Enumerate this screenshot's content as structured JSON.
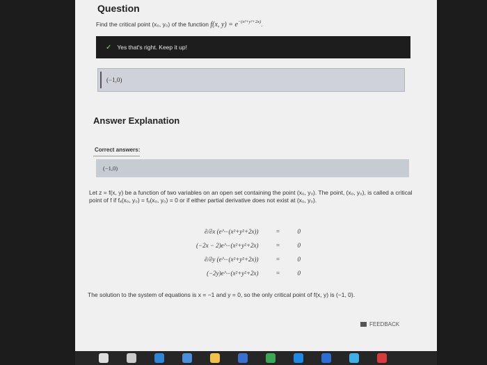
{
  "question": {
    "heading": "Question",
    "prompt_prefix": "Find the critical point (x₀, y₀) of the function",
    "function": "f(x, y) = e",
    "exponent": "−(x²+y²+2x)",
    "period": "."
  },
  "feedback": {
    "message": "Yes that's right. Keep it up!"
  },
  "answer": {
    "value": "(−1,0)"
  },
  "explanation": {
    "heading": "Answer Explanation",
    "correct_label": "Correct answers:",
    "correct_value": "(−1,0)",
    "paragraph": "Let z = f(x, y) be a function of two variables on an open set containing the point (x₀, y₀). The point, (x₀, y₀), is called a critical point of f if fₓ(x₀, y₀) = fᵧ(x₀, y₀) = 0 or if either partial derivative does not exist at (x₀, y₀).",
    "equations": [
      {
        "lhs": "∂/∂x (e^−(x²+y²+2x))",
        "rhs": "0"
      },
      {
        "lhs": "(−2x − 2)e^−(x²+y²+2x)",
        "rhs": "0"
      },
      {
        "lhs": "∂/∂y (e^−(x²+y²+2x))",
        "rhs": "0"
      },
      {
        "lhs": "(−2y)e^−(x²+y²+2x)",
        "rhs": "0"
      }
    ],
    "equals_sign": "=",
    "conclusion": "The solution to the system of equations is x = −1 and y = 0, so the only critical point of f(x, y) is (−1, 0)."
  },
  "feedback_button": {
    "label": "FEEDBACK"
  },
  "taskbar": {
    "icons": [
      {
        "name": "search-icon",
        "color": "#dddddd"
      },
      {
        "name": "task-view-icon",
        "color": "#cccccc"
      },
      {
        "name": "edge-icon",
        "color": "#2f86d6"
      },
      {
        "name": "store-icon",
        "color": "#4a8fd8"
      },
      {
        "name": "explorer-icon",
        "color": "#f0c24a"
      },
      {
        "name": "photos-icon",
        "color": "#3a6fd0"
      },
      {
        "name": "chrome-icon",
        "color": "#3aa757"
      },
      {
        "name": "vscode-icon",
        "color": "#1e88e5"
      },
      {
        "name": "mail-icon",
        "color": "#2b6fd6"
      },
      {
        "name": "calendar-icon",
        "color": "#3fb0e6"
      },
      {
        "name": "app-icon",
        "color": "#d83b3b"
      }
    ]
  }
}
